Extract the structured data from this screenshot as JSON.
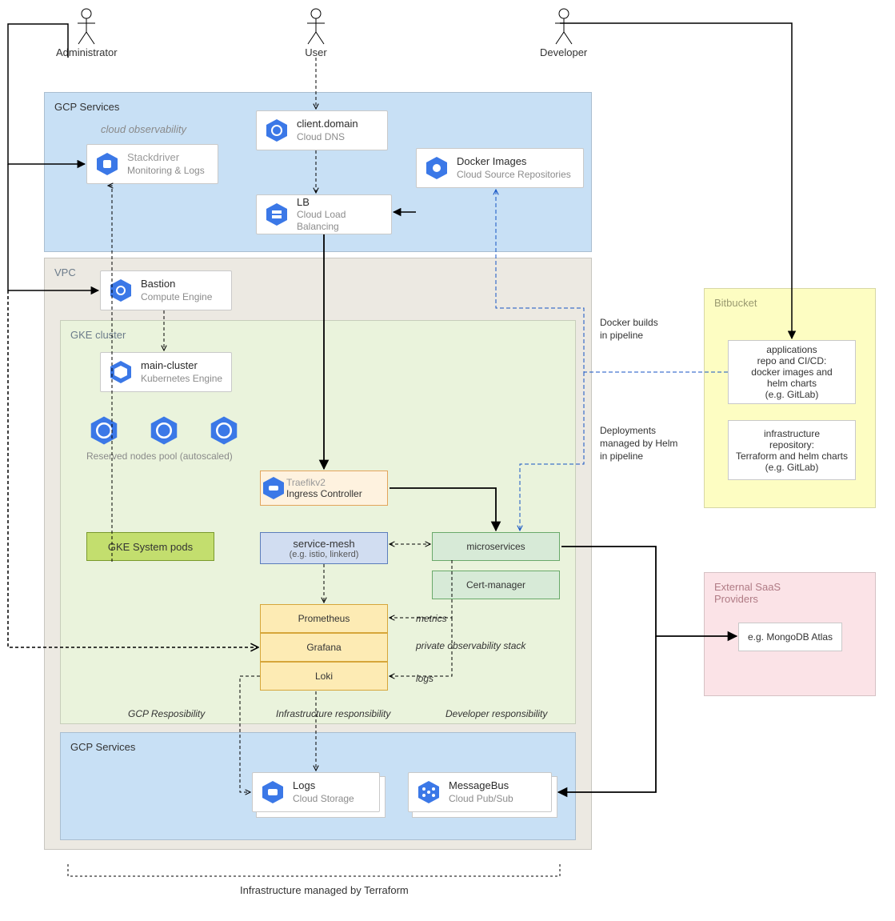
{
  "actors": {
    "admin": "Administrator",
    "user": "User",
    "dev": "Developer"
  },
  "gcp_top": {
    "title": "GCP Services",
    "subtitle": "cloud observability",
    "stackdriver": {
      "title": "Stackdriver",
      "subtitle": "Monitoring & Logs"
    },
    "dns": {
      "title": "client.domain",
      "subtitle": "Cloud DNS"
    },
    "docker": {
      "title": "Docker Images",
      "subtitle": "Cloud Source Repositories"
    },
    "lb": {
      "title": "LB",
      "subtitle": "Cloud Load Balancing"
    }
  },
  "vpc": {
    "title": "VPC",
    "bastion": {
      "title": "Bastion",
      "subtitle": "Compute Engine"
    }
  },
  "gke": {
    "title": "GKE cluster",
    "main": {
      "title": "main-cluster",
      "subtitle": "Kubernetes Engine"
    },
    "pool_label": "Reserved nodes pool (autoscaled)",
    "ingress": {
      "title": "Traefikv2",
      "subtitle": "Ingress Controller"
    },
    "system_pods": "GKE System pods",
    "mesh": {
      "title": "service-mesh",
      "subtitle": "(e.g. istio, linkerd)"
    },
    "microservices": "microservices",
    "certmanager": "Cert-manager",
    "prometheus": "Prometheus",
    "grafana": "Grafana",
    "loki": "Loki",
    "obs_stack_label": "private observability stack",
    "resp_gcp": "GCP Resposibility",
    "resp_infra": "Infrastructure responsibility",
    "resp_dev": "Developer responsibility"
  },
  "edge_labels": {
    "metrics": "metrics",
    "logs": "logs",
    "docker_builds": "Docker builds\nin pipeline",
    "helm_deploy": "Deployments\nmanaged by Helm\nin pipeline"
  },
  "gcp_bottom": {
    "title": "GCP Services",
    "logs": {
      "title": "Logs",
      "subtitle": "Cloud Storage"
    },
    "bus": {
      "title": "MessageBus",
      "subtitle": "Cloud Pub/Sub"
    }
  },
  "bitbucket": {
    "title": "Bitbucket",
    "repo_apps": "applications\nrepo and CI/CD:\ndocker images and\nhelm charts\n(e.g. GitLab)",
    "repo_infra": "infrastructure\nrepository:\nTerraform and helm charts\n(e.g. GitLab)"
  },
  "external": {
    "title": "External SaaS\nProviders",
    "example": "e.g. MongoDB Atlas"
  },
  "footer": "Infrastructure managed by Terraform"
}
